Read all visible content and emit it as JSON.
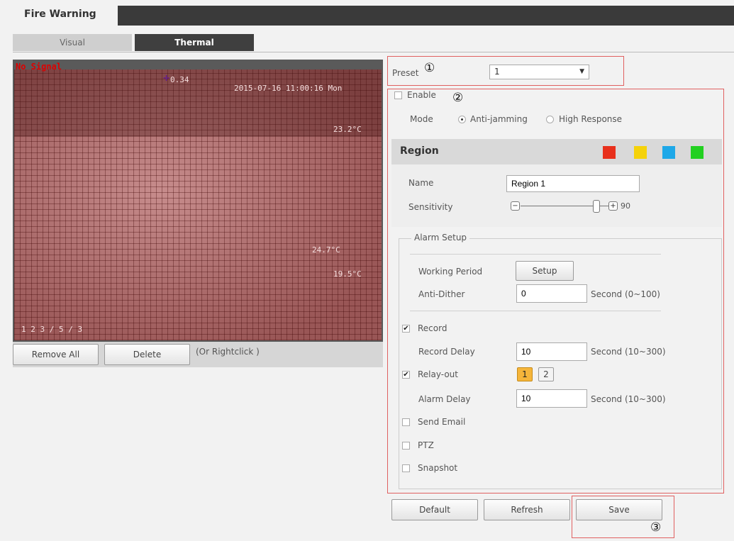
{
  "tabs": {
    "main": "Fire Warning"
  },
  "view_tabs": {
    "visual": "Visual",
    "thermal": "Thermal"
  },
  "video": {
    "status": "No Signal",
    "timestamp": "2015-07-16 11:00:16 Mon",
    "overlay_1": "0.34",
    "overlay_2": "23.2°C",
    "overlay_3": "24.7°C",
    "overlay_4": "19.5°C",
    "overlay_bottom": "1 2 3 / 5 / 3"
  },
  "video_buttons": {
    "remove_all": "Remove All",
    "delete": "Delete",
    "hint": "(Or Rightclick )"
  },
  "preset": {
    "label": "Preset",
    "value": "1",
    "marker": "①"
  },
  "enable": {
    "label": "Enable",
    "checked": false,
    "marker": "②"
  },
  "mode": {
    "label": "Mode",
    "option1": "Anti-jamming",
    "option2": "High Response",
    "selected": "Anti-jamming"
  },
  "region": {
    "title": "Region",
    "colors": [
      "#e8301c",
      "#f5d20a",
      "#1ea8e8",
      "#22d020"
    ],
    "name_label": "Name",
    "name_value": "Region 1",
    "sensitivity_label": "Sensitivity",
    "sensitivity_value": "90",
    "minus": "−",
    "plus": "+"
  },
  "alarm": {
    "legend": "Alarm Setup",
    "working_period_label": "Working Period",
    "setup_button": "Setup",
    "anti_dither_label": "Anti-Dither",
    "anti_dither_value": "0",
    "anti_dither_unit": "Second (0~100)",
    "record_label": "Record",
    "record_checked": true,
    "record_delay_label": "Record Delay",
    "record_delay_value": "10",
    "record_delay_unit": "Second (10~300)",
    "relay_label": "Relay-out",
    "relay_checked": true,
    "relay_1": "1",
    "relay_2": "2",
    "alarm_delay_label": "Alarm Delay",
    "alarm_delay_value": "10",
    "alarm_delay_unit": "Second (10~300)",
    "send_email_label": "Send Email",
    "ptz_label": "PTZ",
    "snapshot_label": "Snapshot"
  },
  "footer": {
    "default": "Default",
    "refresh": "Refresh",
    "save": "Save",
    "marker": "③"
  }
}
